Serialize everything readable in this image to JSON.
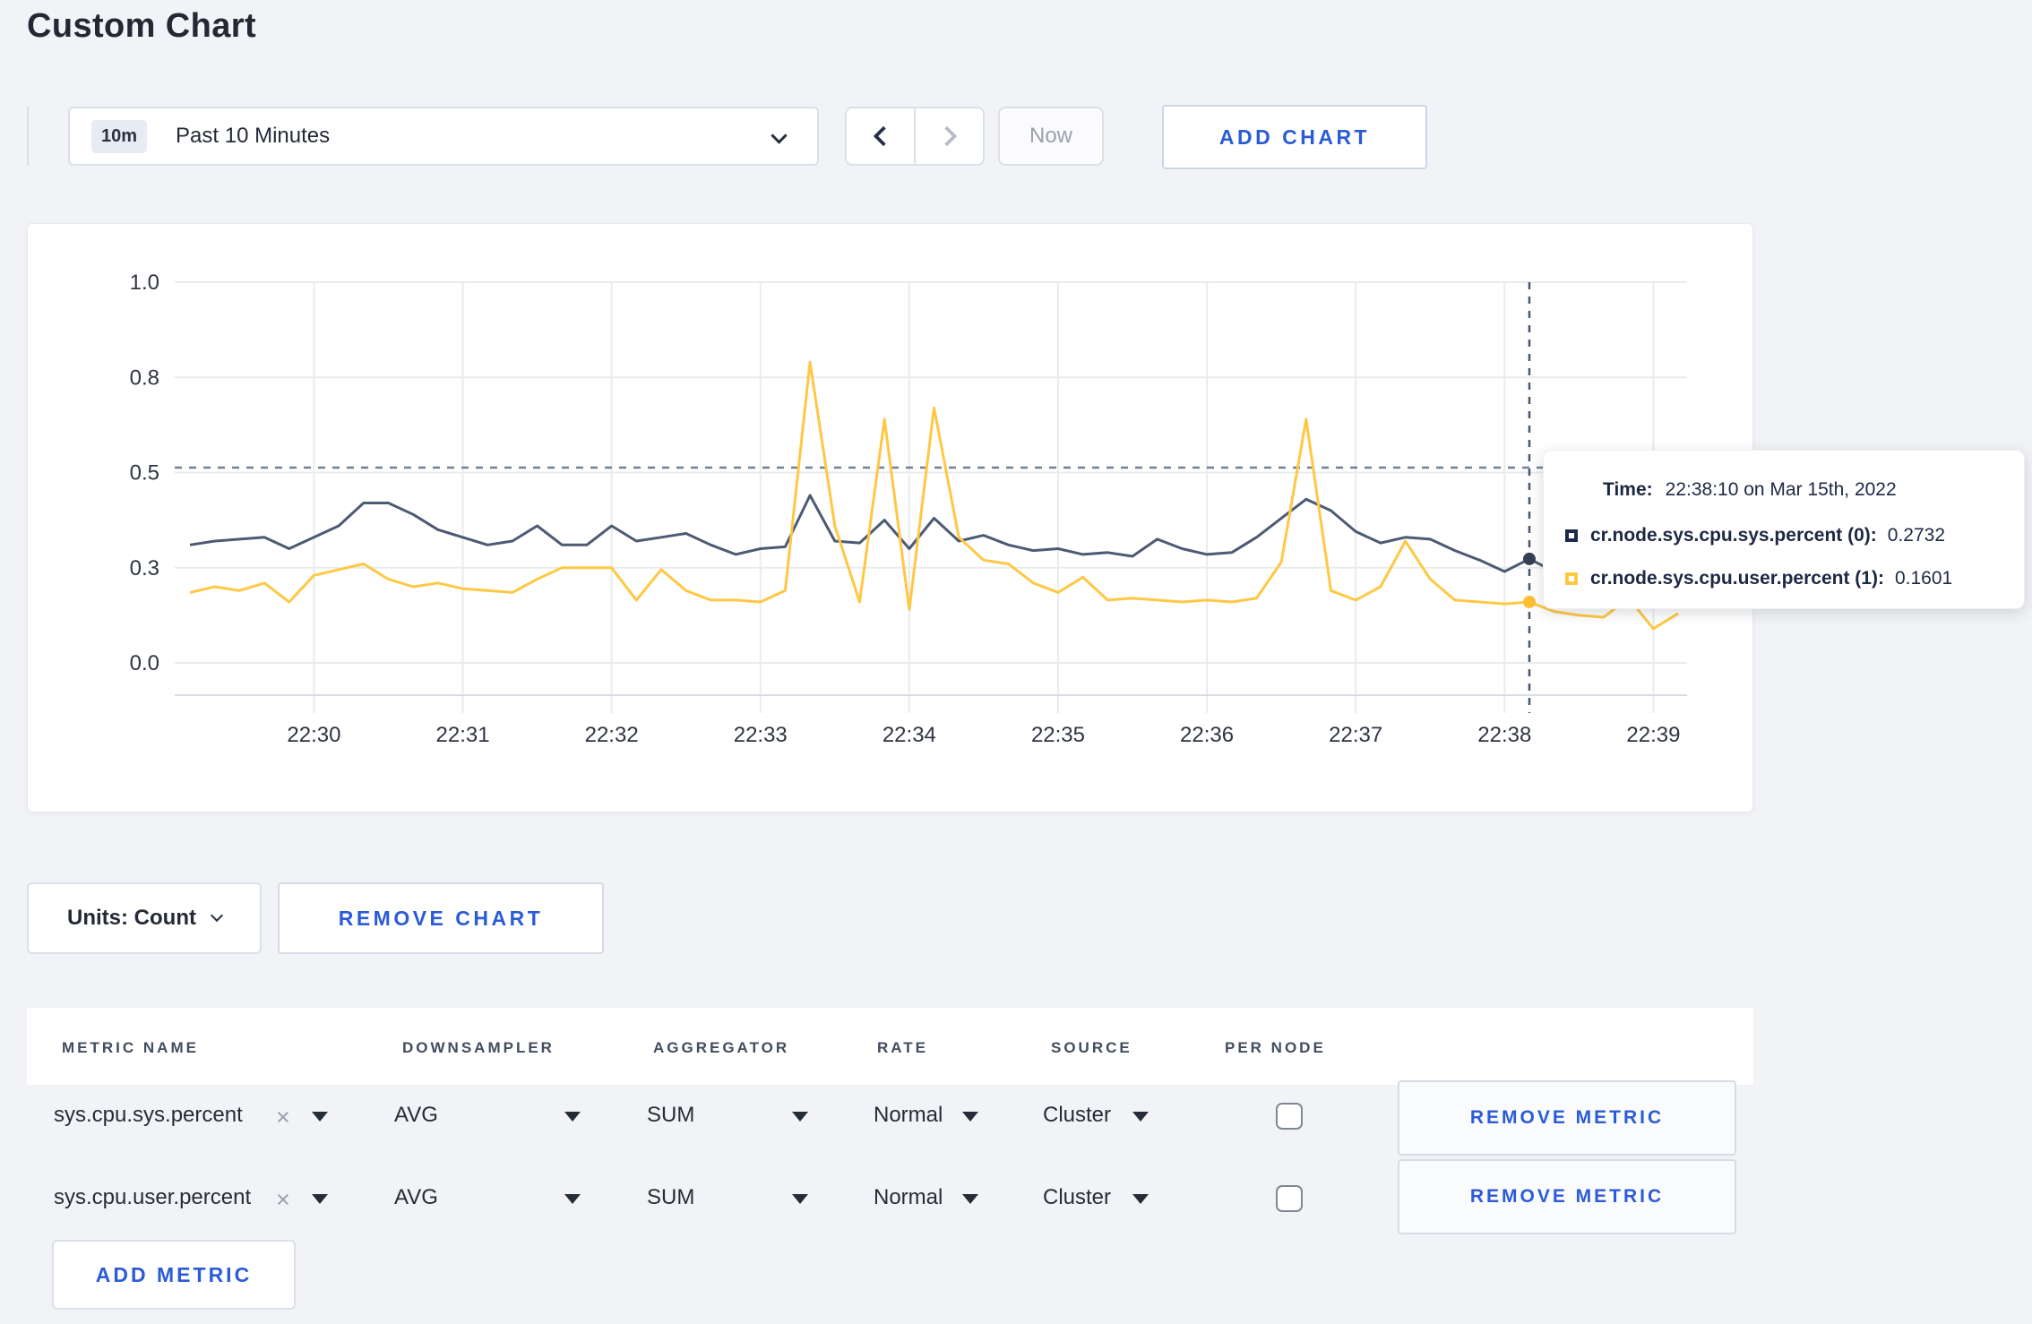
{
  "page": {
    "title": "Custom Chart",
    "background": "#f2f3f6"
  },
  "toolbar": {
    "time_window_badge": "10m",
    "time_window_label": "Past 10 Minutes",
    "prev_icon": "chevron-left",
    "next_icon": "chevron-right",
    "now_label": "Now",
    "add_chart_label": "ADD CHART"
  },
  "chart_controls": {
    "units_label": "Units: Count",
    "remove_chart_label": "REMOVE CHART"
  },
  "tooltip": {
    "time_label": "Time:",
    "time_value": "22:38:10 on Mar 15th, 2022",
    "series": [
      {
        "name": "cr.node.sys.cpu.sys.percent (0):",
        "value": "0.2732",
        "color": "#1c2b4a"
      },
      {
        "name": "cr.node.sys.cpu.user.percent (1):",
        "value": "0.1601",
        "color": "#ffc844"
      }
    ]
  },
  "chart_data": {
    "type": "line",
    "title": "",
    "xlabel": "",
    "ylabel": "",
    "ylim": [
      0,
      1
    ],
    "grid": true,
    "x_start": "22:29:10",
    "x_step_seconds": 10,
    "x_ticks": [
      {
        "index": 5,
        "label": "22:30"
      },
      {
        "index": 11,
        "label": "22:31"
      },
      {
        "index": 17,
        "label": "22:32"
      },
      {
        "index": 23,
        "label": "22:33"
      },
      {
        "index": 29,
        "label": "22:34"
      },
      {
        "index": 35,
        "label": "22:35"
      },
      {
        "index": 41,
        "label": "22:36"
      },
      {
        "index": 47,
        "label": "22:37"
      },
      {
        "index": 53,
        "label": "22:38"
      },
      {
        "index": 59,
        "label": "22:39"
      }
    ],
    "y_ticks": [
      {
        "value": 0,
        "label": "0.0"
      },
      {
        "value": 0.25,
        "label": "0.3"
      },
      {
        "value": 0.5,
        "label": "0.5"
      },
      {
        "value": 0.75,
        "label": "0.8"
      },
      {
        "value": 1,
        "label": "1.0"
      }
    ],
    "threshold_line": {
      "value": 0.513,
      "style": "dashed",
      "color": "#6f8198"
    },
    "crosshair": {
      "index": 54,
      "time": "22:38:10",
      "color": "#47586f"
    },
    "series": [
      {
        "name": "cr.node.sys.cpu.sys.percent",
        "color": "#4d5a73",
        "dot_color": "#343f56",
        "values": [
          0.31,
          0.32,
          0.325,
          0.33,
          0.3,
          0.33,
          0.36,
          0.42,
          0.42,
          0.39,
          0.35,
          0.33,
          0.31,
          0.32,
          0.36,
          0.31,
          0.31,
          0.36,
          0.32,
          0.33,
          0.34,
          0.31,
          0.285,
          0.3,
          0.305,
          0.44,
          0.32,
          0.315,
          0.375,
          0.3,
          0.38,
          0.32,
          0.335,
          0.31,
          0.295,
          0.3,
          0.285,
          0.29,
          0.28,
          0.325,
          0.3,
          0.285,
          0.29,
          0.33,
          0.38,
          0.43,
          0.4,
          0.345,
          0.315,
          0.33,
          0.325,
          0.295,
          0.27,
          0.24,
          0.2732,
          0.24,
          0.27,
          0.3,
          0.31,
          0.295,
          0.305
        ]
      },
      {
        "name": "cr.node.sys.cpu.user.percent",
        "color": "#ffc844",
        "dot_color": "#ffbe33",
        "values": [
          0.185,
          0.2,
          0.19,
          0.21,
          0.16,
          0.23,
          0.245,
          0.26,
          0.22,
          0.2,
          0.21,
          0.195,
          0.19,
          0.185,
          0.22,
          0.25,
          0.25,
          0.25,
          0.165,
          0.245,
          0.19,
          0.165,
          0.165,
          0.16,
          0.19,
          0.79,
          0.36,
          0.16,
          0.64,
          0.14,
          0.67,
          0.33,
          0.27,
          0.26,
          0.21,
          0.185,
          0.225,
          0.165,
          0.17,
          0.165,
          0.16,
          0.165,
          0.16,
          0.17,
          0.265,
          0.64,
          0.19,
          0.165,
          0.2,
          0.32,
          0.22,
          0.165,
          0.16,
          0.155,
          0.1601,
          0.135,
          0.125,
          0.12,
          0.17,
          0.09,
          0.13
        ]
      }
    ],
    "highlighted_points": [
      {
        "series": 0,
        "index": 54,
        "value": 0.2732
      },
      {
        "series": 1,
        "index": 54,
        "value": 0.1601
      }
    ]
  },
  "metrics_table": {
    "headers": [
      "METRIC NAME",
      "DOWNSAMPLER",
      "AGGREGATOR",
      "RATE",
      "SOURCE",
      "PER NODE"
    ],
    "clear_icon": "×",
    "rows": [
      {
        "metric": "sys.cpu.sys.percent",
        "downsampler": "AVG",
        "aggregator": "SUM",
        "rate": "Normal",
        "source": "Cluster",
        "per_node_checked": false,
        "remove_label": "REMOVE METRIC"
      },
      {
        "metric": "sys.cpu.user.percent",
        "downsampler": "AVG",
        "aggregator": "SUM",
        "rate": "Normal",
        "source": "Cluster",
        "per_node_checked": false,
        "remove_label": "REMOVE METRIC"
      }
    ],
    "add_metric_label": "ADD METRIC"
  }
}
